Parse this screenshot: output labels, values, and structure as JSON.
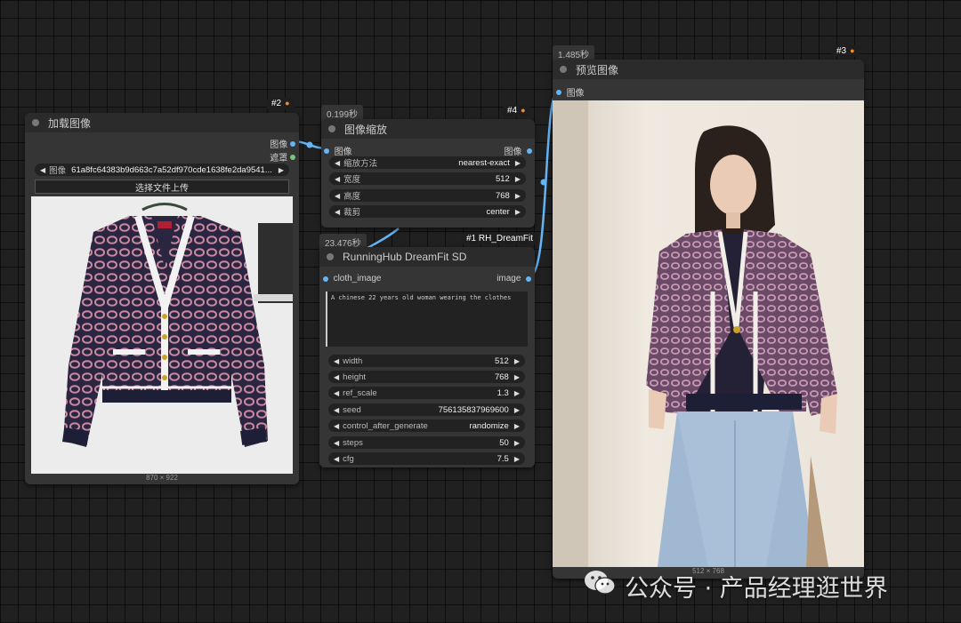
{
  "load_node": {
    "badge": "#2",
    "title": "加载图像",
    "outputs": [
      "图像",
      "遮罩"
    ],
    "file_label": "图像",
    "file_value": "61a8fc64383b9d663c7a52df970cde1638fe2da9541...",
    "upload_label": "选择文件上传",
    "image_size": "870 × 922"
  },
  "scale_node": {
    "timer": "0.199秒",
    "badge": "#4",
    "title": "图像缩放",
    "input": "图像",
    "output": "图像",
    "widgets": [
      {
        "label": "缩放方法",
        "value": "nearest-exact"
      },
      {
        "label": "宽度",
        "value": "512"
      },
      {
        "label": "高度",
        "value": "768"
      },
      {
        "label": "裁剪",
        "value": "center"
      }
    ]
  },
  "dreamfit_node": {
    "timer": "23.476秒",
    "badge": "#1 RH_DreamFit",
    "title": "RunningHub DreamFit SD",
    "input": "cloth_image",
    "output": "image",
    "prompt": "A chinese 22 years old woman wearing the clothes",
    "widgets": [
      {
        "label": "width",
        "value": "512"
      },
      {
        "label": "height",
        "value": "768"
      },
      {
        "label": "ref_scale",
        "value": "1.3"
      },
      {
        "label": "seed",
        "value": "756135837969600"
      },
      {
        "label": "control_after_generate",
        "value": "randomize"
      },
      {
        "label": "steps",
        "value": "50"
      },
      {
        "label": "cfg",
        "value": "7.5"
      }
    ]
  },
  "preview_node": {
    "timer": "1.485秒",
    "badge": "#3",
    "title": "预览图像",
    "input": "图像",
    "image_size": "512 × 768"
  },
  "watermark": {
    "text": "公众号 · 产品经理逛世界"
  },
  "colors": {
    "link": "#64b5f6",
    "node_bg": "#353535",
    "title_bg": "#2b2b2b",
    "canvas_bg": "#202020"
  }
}
